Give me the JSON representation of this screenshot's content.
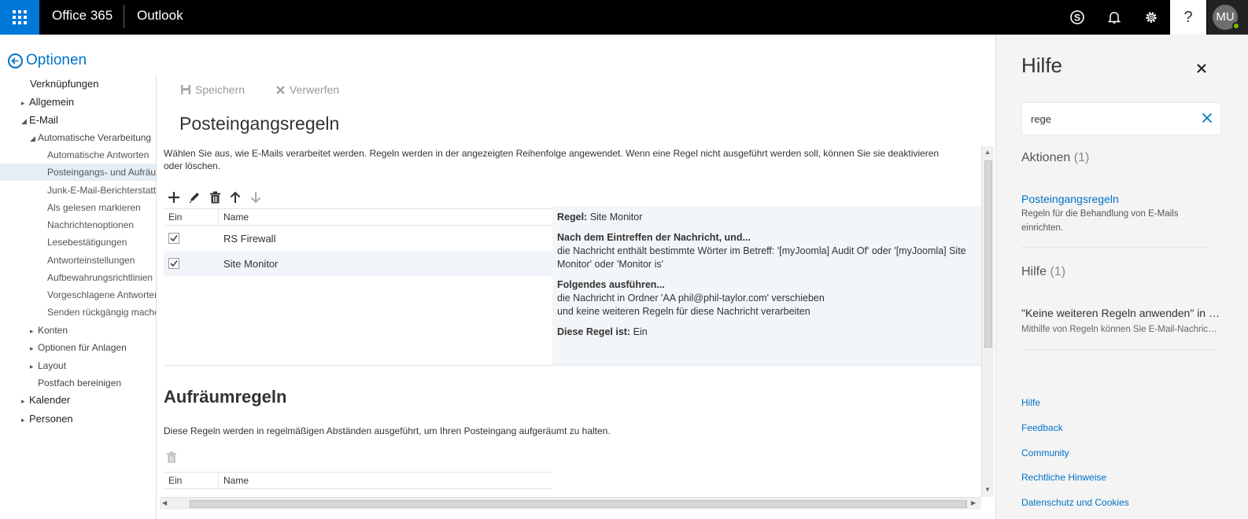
{
  "topbar": {
    "brand": "Office 365",
    "app": "Outlook",
    "icons": [
      "waffle-icon",
      "skype-icon",
      "bell-icon",
      "gear-icon",
      "help-icon"
    ],
    "help_label": "?",
    "avatar_initials": "MU",
    "accent": "#0078d7"
  },
  "nav": {
    "back_label": "Optionen",
    "items": [
      {
        "label": "Verknüpfungen"
      },
      {
        "label": "Allgemein"
      },
      {
        "label": "E-Mail"
      },
      {
        "label": "Automatische Verarbeitung"
      },
      {
        "label": "Automatische Antworten"
      },
      {
        "label": "Posteingangs- und Aufräumregeln"
      },
      {
        "label": "Junk-E-Mail-Berichterstattung"
      },
      {
        "label": "Als gelesen markieren"
      },
      {
        "label": "Nachrichtenoptionen"
      },
      {
        "label": "Lesebestätigungen"
      },
      {
        "label": "Antworteinstellungen"
      },
      {
        "label": "Aufbewahrungsrichtlinien"
      },
      {
        "label": "Vorgeschlagene Antworten"
      },
      {
        "label": "Senden rückgängig machen"
      },
      {
        "label": "Konten"
      },
      {
        "label": "Optionen für Anlagen"
      },
      {
        "label": "Layout"
      },
      {
        "label": "Postfach bereinigen"
      },
      {
        "label": "Kalender"
      },
      {
        "label": "Personen"
      }
    ]
  },
  "main": {
    "save_label": "Speichern",
    "discard_label": "Verwerfen",
    "title": "Posteingangsregeln",
    "description": "Wählen Sie aus, wie E-Mails verarbeitet werden. Regeln werden in der angezeigten Reihenfolge angewendet. Wenn eine Regel nicht ausgeführt werden soll, können Sie sie deaktivieren oder löschen.",
    "columns": {
      "on": "Ein",
      "name": "Name"
    },
    "rules": [
      {
        "name": "RS Firewall",
        "enabled": true
      },
      {
        "name": "Site Monitor",
        "enabled": true
      }
    ],
    "detail": {
      "rule_label": "Regel:",
      "rule_name": "Site Monitor",
      "condition_heading": "Nach dem Eintreffen der Nachricht, und...",
      "condition_text": "die Nachricht enthält bestimmte Wörter im Betreff: '[myJoomla] Audit Of' oder '[myJoomla] Site Monitor' oder 'Monitor is'",
      "action_heading": "Folgendes ausführen...",
      "action_line1": "die Nachricht in Ordner 'AA phil@phil-taylor.com' verschieben",
      "action_line2": "und keine weiteren Regeln für diese Nachricht verarbeiten",
      "status_label": "Diese Regel ist:",
      "status_value": "Ein"
    },
    "cleanup": {
      "title": "Aufräumregeln",
      "description": "Diese Regeln werden in regelmäßigen Abständen ausgeführt, um Ihren Posteingang aufgeräumt zu halten.",
      "columns": {
        "on": "Ein",
        "name": "Name"
      }
    }
  },
  "help": {
    "title": "Hilfe",
    "search_value": "rege",
    "actions_heading": "Aktionen",
    "actions_count": "(1)",
    "action_link": "Posteingangsregeln",
    "action_text": "Regeln für die Behandlung von E-Mails einrichten.",
    "help_heading": "Hilfe",
    "help_count": "(1)",
    "result_title": "\"Keine weiteren Regeln anwenden\" in Outlook",
    "result_text": "Mithilfe von Regeln können Sie E-Mail-Nachrichten automatisch",
    "footer": [
      "Hilfe",
      "Feedback",
      "Community",
      "Rechtliche Hinweise",
      "Datenschutz und Cookies"
    ]
  }
}
